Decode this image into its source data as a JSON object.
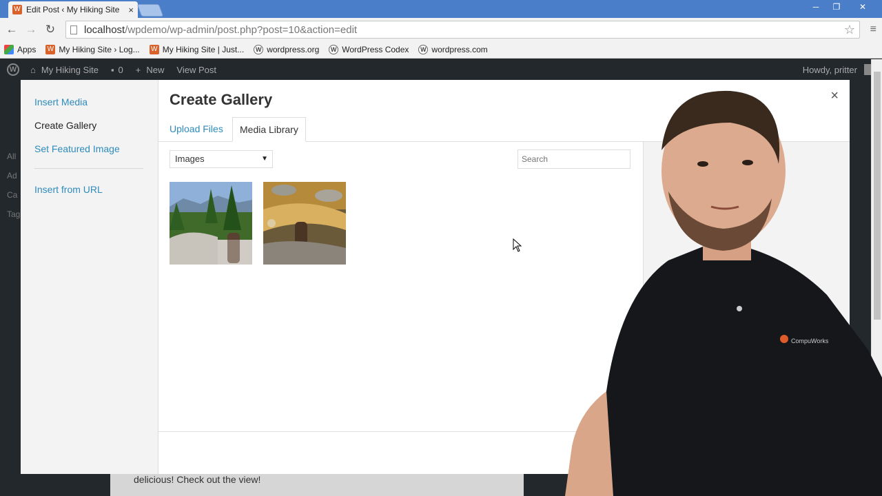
{
  "browser": {
    "tab_title": "Edit Post ‹ My Hiking Site",
    "tab_close": "×",
    "url_host": "localhost",
    "url_path": "/wpdemo/wp-admin/post.php?post=10&action=edit",
    "window_controls": [
      "─",
      "❐",
      "✕"
    ]
  },
  "bookmarks": [
    {
      "label": "Apps",
      "icon": "apps-grid-icon"
    },
    {
      "label": "My Hiking Site › Log...",
      "icon": "site-icon"
    },
    {
      "label": "My Hiking Site | Just...",
      "icon": "site-icon"
    },
    {
      "label": "wordpress.org",
      "icon": "wordpress-icon"
    },
    {
      "label": "WordPress Codex",
      "icon": "wordpress-icon"
    },
    {
      "label": "wordpress.com",
      "icon": "wordpress-icon"
    }
  ],
  "adminbar": {
    "site_name": "My Hiking Site",
    "comments_count": "0",
    "new_label": "New",
    "view_post": "View Post",
    "howdy": "Howdy, pritter"
  },
  "wp_sidebar_fragments": [
    "All",
    "Ad",
    "Ca",
    "Tag"
  ],
  "modal": {
    "menu": {
      "insert_media": "Insert Media",
      "create_gallery": "Create Gallery",
      "set_featured": "Set Featured Image",
      "insert_url": "Insert from URL"
    },
    "title": "Create Gallery",
    "close": "×",
    "tabs": {
      "upload": "Upload Files",
      "library": "Media Library"
    },
    "filter_selected": "Images",
    "search_placeholder": "Search",
    "attachments": [
      {
        "name": "hiking-view-thumbnail"
      },
      {
        "name": "river-boots-thumbnail"
      }
    ]
  },
  "post_content_fragment": "delicious! Check out the view!",
  "colors": {
    "wp_dark": "#23282d",
    "link_blue": "#2e8bbb",
    "primary_button": "#2ea2cc",
    "chrome_blue": "#4a7ec9"
  }
}
